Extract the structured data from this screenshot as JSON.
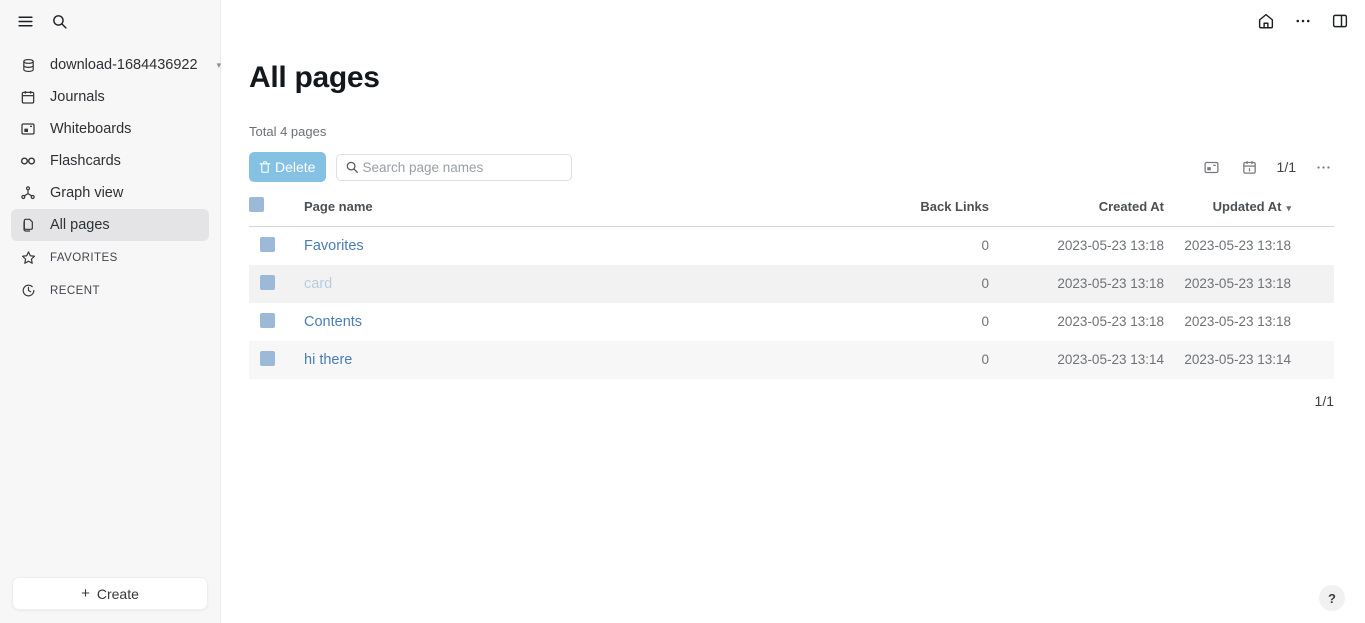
{
  "sidebar": {
    "menu_icon": "hamburger-menu-icon",
    "search_icon": "search-icon",
    "graph": {
      "label": "download-1684436922",
      "icon": "database-icon",
      "caret": "▾"
    },
    "items": [
      {
        "label": "Journals",
        "icon": "calendar-icon",
        "active": false
      },
      {
        "label": "Whiteboards",
        "icon": "whiteboard-icon",
        "active": false
      },
      {
        "label": "Flashcards",
        "icon": "infinity-icon",
        "active": false
      },
      {
        "label": "Graph view",
        "icon": "graph-node-icon",
        "active": false
      },
      {
        "label": "All pages",
        "icon": "pages-copy-icon",
        "active": true
      }
    ],
    "sections": [
      {
        "label": "FAVORITES",
        "icon": "star-icon"
      },
      {
        "label": "RECENT",
        "icon": "clock-icon"
      }
    ],
    "create_label": "Create",
    "create_plus": "+"
  },
  "topbar": {
    "home_icon": "home-icon",
    "more_icon": "more-horizontal-icon",
    "right_sidebar_icon": "right-sidebar-toggle-icon"
  },
  "main": {
    "title": "All pages",
    "total_text": "Total 4 pages",
    "delete_label": "Delete",
    "delete_icon": "trash-icon",
    "delete_color": "#84c1e3",
    "search": {
      "value": "",
      "placeholder": "Search page names",
      "icon": "search-icon"
    },
    "toolbar_right": {
      "whiteboard_icon": "whiteboard-layout-icon",
      "calendar_icon": "calendar-day-icon",
      "pagination": "1/1",
      "more_icon": "more-horizontal-icon"
    },
    "table": {
      "columns": [
        "Page name",
        "Back Links",
        "Created At",
        "Updated At"
      ],
      "sort_column": "Updated At",
      "sort_caret": "▾",
      "rows": [
        {
          "name": "Favorites",
          "back_links": "0",
          "created_at": "2023-05-23 13:18",
          "updated_at": "2023-05-23 13:18",
          "striped": false,
          "dim": false
        },
        {
          "name": "card",
          "back_links": "0",
          "created_at": "2023-05-23 13:18",
          "updated_at": "2023-05-23 13:18",
          "striped": true,
          "dim": true
        },
        {
          "name": "Contents",
          "back_links": "0",
          "created_at": "2023-05-23 13:18",
          "updated_at": "2023-05-23 13:18",
          "striped": false,
          "dim": false
        },
        {
          "name": "hi there",
          "back_links": "0",
          "created_at": "2023-05-23 13:14",
          "updated_at": "2023-05-23 13:14",
          "striped": true,
          "dim": false
        }
      ]
    },
    "footer_pagination": "1/1",
    "help_label": "?"
  }
}
